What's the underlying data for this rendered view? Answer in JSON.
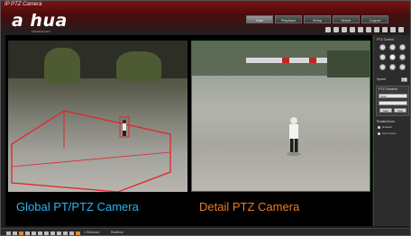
{
  "window": {
    "title": "IP PTZ Camera",
    "brand": "a hua",
    "brand_sub": "TECHNOLOGY"
  },
  "tabs": [
    {
      "label": "Live",
      "active": true
    },
    {
      "label": "Playback",
      "active": false
    },
    {
      "label": "Setup",
      "active": false
    },
    {
      "label": "Alarm",
      "active": false
    },
    {
      "label": "Logout",
      "active": false
    }
  ],
  "video": {
    "left_caption": "Global PT/PTZ Camera",
    "right_caption": "Detail PTZ Camera",
    "left_caption_color": "#27b6f0",
    "right_caption_color": "#f07b1f"
  },
  "ptz": {
    "title": "PTZ Control",
    "speed_label": "Speed",
    "speed_value": "5",
    "preset_title": "PTZ Function",
    "select_value": "Scan",
    "buttons": [
      "Start",
      "Stop"
    ],
    "radio_title": "Rotate/Zoom",
    "radio_options": [
      "Rotation",
      "Zoom focus"
    ]
  },
  "statusbar": {
    "zoom_text": "1 Windows",
    "mode_text": "Realtime"
  },
  "colors": {
    "header_accent": "#7a1414",
    "zone_red": "#e0262b"
  }
}
